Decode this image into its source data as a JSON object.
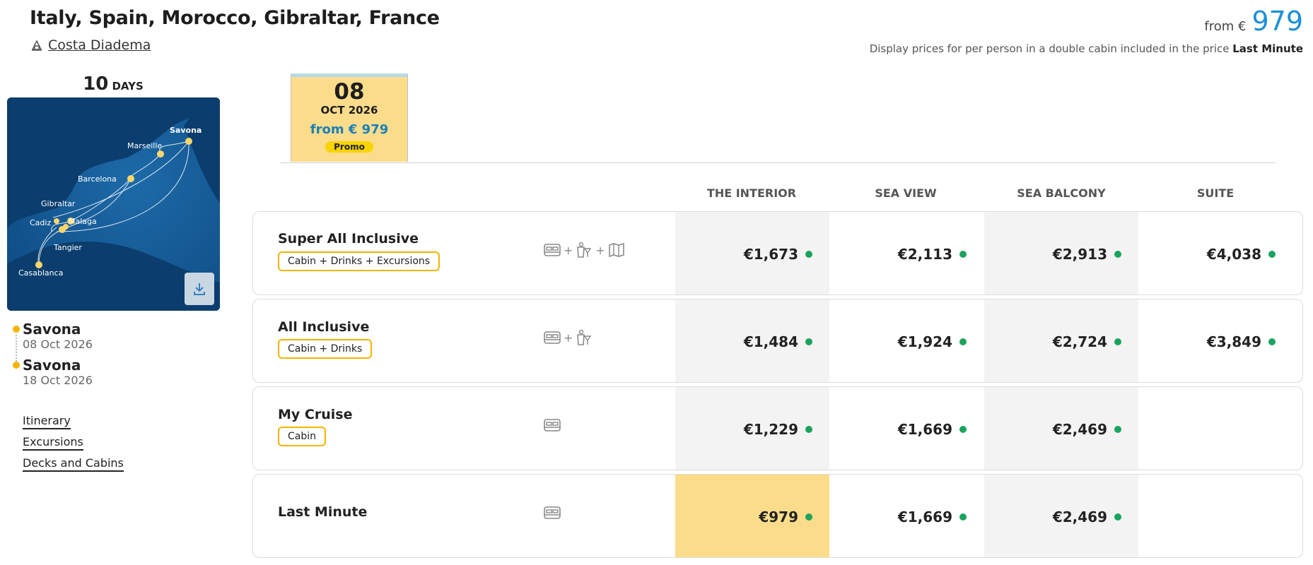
{
  "header": {
    "title": "Italy, Spain, Morocco, Gibraltar, France",
    "ship_name": "Costa Diadema",
    "price_from_label": "from €",
    "price_from_value": "979",
    "disclaimer_text": "Display prices for per person in a double cabin included in the price",
    "disclaimer_fare": "Last Minute"
  },
  "trip": {
    "days_number": "10",
    "days_label": "DAYS",
    "map_labels": {
      "savona": "Savona",
      "marseille": "Marseille",
      "barcelona": "Barcelona",
      "gibraltar": "Gibraltar",
      "cadiz": "Cadiz",
      "malaga": "Malaga",
      "tangier": "Tangier",
      "casablanca": "Casablanca"
    },
    "departure": {
      "port": "Savona",
      "date": "08 Oct 2026"
    },
    "arrival": {
      "port": "Savona",
      "date": "18 Oct 2026"
    },
    "links": [
      "Itinerary",
      "Excursions",
      "Decks and Cabins"
    ]
  },
  "date_card": {
    "day": "08",
    "month": "OCT 2026",
    "from_price": "from € 979",
    "promo": "Promo"
  },
  "columns": [
    "THE INTERIOR",
    "SEA VIEW",
    "SEA BALCONY",
    "SUITE"
  ],
  "fares": [
    {
      "name": "Super All Inclusive",
      "badge": "Cabin + Drinks + Excursions",
      "icons": [
        "cabin-icon",
        "drinks-icon",
        "excursion-map-icon"
      ],
      "prices": [
        "€1,673",
        "€2,113",
        "€2,913",
        "€4,038"
      ]
    },
    {
      "name": "All Inclusive",
      "badge": "Cabin + Drinks",
      "icons": [
        "cabin-icon",
        "drinks-icon"
      ],
      "prices": [
        "€1,484",
        "€1,924",
        "€2,724",
        "€3,849"
      ]
    },
    {
      "name": "My Cruise",
      "badge": "Cabin",
      "icons": [
        "cabin-icon"
      ],
      "prices": [
        "€1,229",
        "€1,669",
        "€2,469",
        ""
      ]
    },
    {
      "name": "Last Minute",
      "badge": "",
      "icons": [
        "cabin-icon"
      ],
      "prices": [
        "€979",
        "€1,669",
        "€2,469",
        ""
      ]
    }
  ],
  "colors": {
    "accent_blue": "#1a8fd8",
    "highlight_yellow": "#fbdc8b",
    "availability_green": "#1aa35c",
    "badge_border": "#f4b400"
  }
}
